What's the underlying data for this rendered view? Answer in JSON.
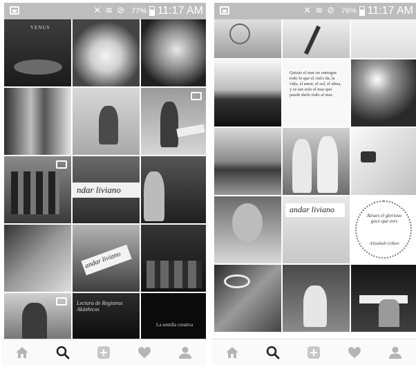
{
  "left": {
    "status": {
      "battery": "77%",
      "time": "11:17 AM"
    },
    "tiles": {
      "venus_title": "VENUS",
      "andar_liviano_1": "ndar liviano",
      "andar_liviano_2": "andar liviano",
      "lectura": "Lectura de Registros Akáshicos",
      "semilla": "La semilla creativa"
    }
  },
  "right": {
    "status": {
      "battery": "76%",
      "time": "11:17 AM"
    },
    "tiles": {
      "poem": "Quizás el mar no entregue todo lo que el cielo da, la vida, el amor, el sol, el alma, y es tan solo el mar que puede darlo todo al mar.",
      "andar_liviano": "andar liviano",
      "quote": "Atraes el glorioso goce que eres",
      "quote_author": "-Elizabeth Gilbert"
    }
  },
  "colors": {
    "statusbar": "#bdbdbd",
    "navbar": "#fafafa"
  },
  "icons": [
    "home-icon",
    "search-icon",
    "add-post-icon",
    "heart-icon",
    "profile-icon",
    "video-icon"
  ]
}
